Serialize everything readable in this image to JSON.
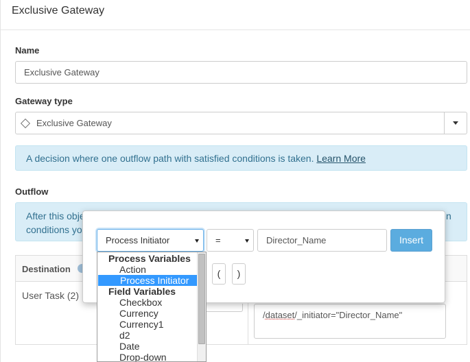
{
  "header": {
    "title": "Exclusive Gateway"
  },
  "name_field": {
    "label": "Name",
    "value": "Exclusive Gateway"
  },
  "gateway_type": {
    "label": "Gateway type",
    "selected": "Exclusive Gateway",
    "icon": "diamond-icon"
  },
  "info": {
    "text": "A decision where one outflow path with satisfied conditions is taken.",
    "link": "Learn More"
  },
  "outflow": {
    "label": "Outflow",
    "info_line1": "After this obje",
    "info_line1_end": "n",
    "info_line2": "conditions yo",
    "table": {
      "header_destination": "Destination",
      "row_destination": "User Task (2)",
      "condition_pre": "/",
      "condition_underlined": "dataset",
      "condition_post": "/_initiator=\"Director_Name\""
    }
  },
  "popover": {
    "variable_select": "Process Initiator",
    "operator_select": "=",
    "value_input": "Director_Name",
    "insert_label": "Insert",
    "open_paren": "(",
    "close_paren": ")"
  },
  "dropdown": {
    "items": [
      {
        "label": "Process Variables",
        "group": true
      },
      {
        "label": "Action"
      },
      {
        "label": "Process Initiator",
        "selected": true
      },
      {
        "label": "Field Variables",
        "group": true
      },
      {
        "label": "Checkbox"
      },
      {
        "label": "Currency"
      },
      {
        "label": "Currency1"
      },
      {
        "label": "d2"
      },
      {
        "label": "Date"
      },
      {
        "label": "Drop-down"
      }
    ]
  },
  "colors": {
    "info_bg": "#d9edf7",
    "info_text": "#31708f",
    "insert_bg": "#5bacdf",
    "selection": "#3399ff"
  }
}
